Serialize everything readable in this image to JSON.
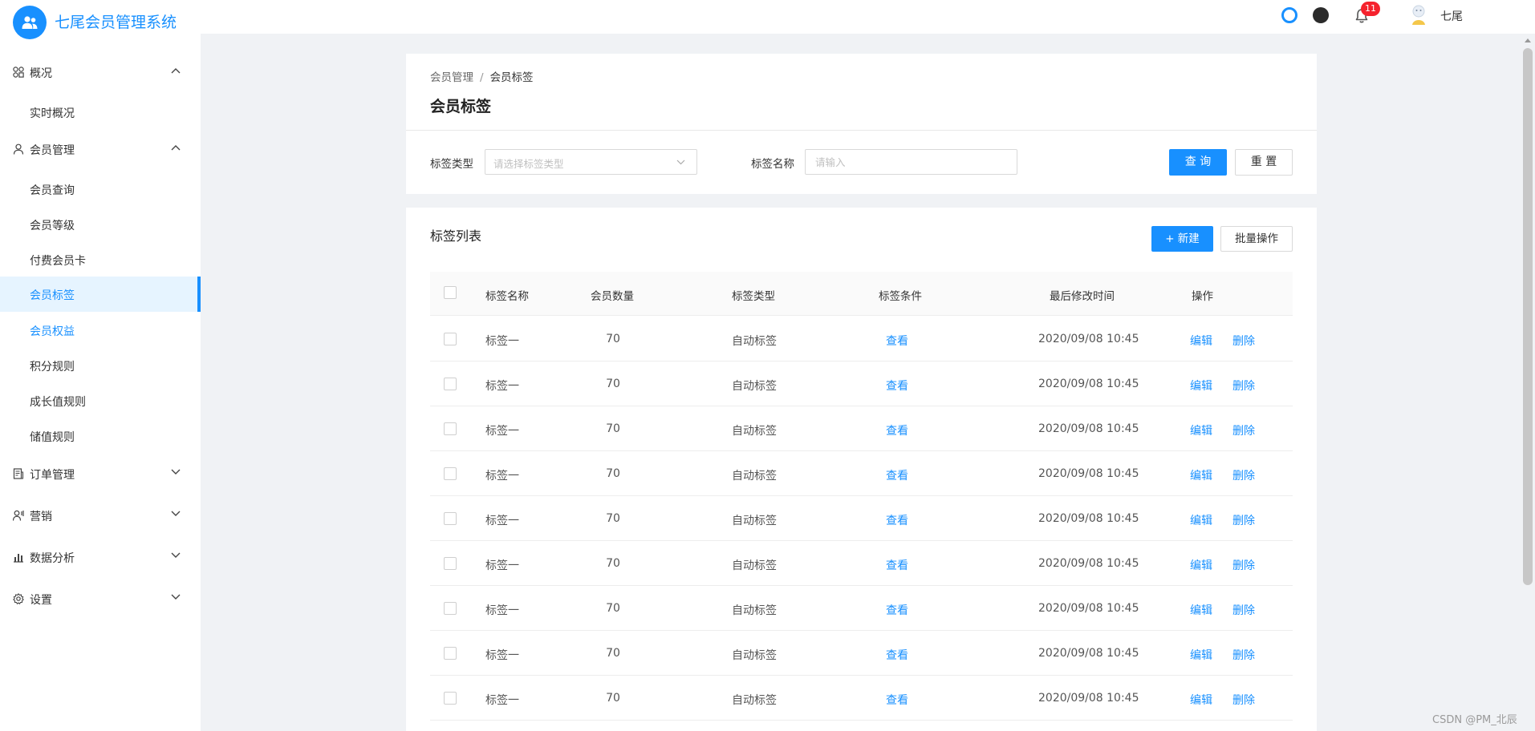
{
  "app": {
    "title": "七尾会员管理系统"
  },
  "header": {
    "notification_count": "11",
    "username": "七尾"
  },
  "sidebar": {
    "groups": [
      {
        "label": "概况",
        "icon": "overview-grid-icon",
        "expanded": true,
        "items": [
          "实时概况"
        ]
      },
      {
        "label": "会员管理",
        "icon": "user-icon",
        "expanded": true,
        "items": [
          "会员查询",
          "会员等级",
          "付费会员卡",
          "会员标签",
          "会员权益",
          "积分规则",
          "成长值规则",
          "储值规则"
        ]
      },
      {
        "label": "订单管理",
        "icon": "order-document-icon",
        "expanded": false
      },
      {
        "label": "营销",
        "icon": "marketing-user-icon",
        "expanded": false
      },
      {
        "label": "数据分析",
        "icon": "bar-chart-icon",
        "expanded": false
      },
      {
        "label": "设置",
        "icon": "gear-icon",
        "expanded": false
      }
    ],
    "active_item": "会员标签",
    "highlighted_item": "会员权益"
  },
  "breadcrumb": {
    "parent": "会员管理",
    "separator": "/",
    "current": "会员标签"
  },
  "page_title": "会员标签",
  "filters": {
    "tag_type_label": "标签类型",
    "tag_type_placeholder": "请选择标签类型",
    "tag_name_label": "标签名称",
    "tag_name_placeholder": "请输入",
    "query_button": "查 询",
    "reset_button": "重 置"
  },
  "list": {
    "title": "标签列表",
    "new_button": "+ 新建",
    "batch_button": "批量操作",
    "columns": [
      "标签名称",
      "会员数量",
      "标签类型",
      "标签条件",
      "最后修改时间",
      "操作"
    ],
    "rows": [
      {
        "name": "标签一",
        "count": "70",
        "type": "自动标签",
        "condition": "查看",
        "modified": "2020/09/08 10:45",
        "edit": "编辑",
        "delete": "删除"
      },
      {
        "name": "标签一",
        "count": "70",
        "type": "自动标签",
        "condition": "查看",
        "modified": "2020/09/08 10:45",
        "edit": "编辑",
        "delete": "删除"
      },
      {
        "name": "标签一",
        "count": "70",
        "type": "自动标签",
        "condition": "查看",
        "modified": "2020/09/08 10:45",
        "edit": "编辑",
        "delete": "删除"
      },
      {
        "name": "标签一",
        "count": "70",
        "type": "自动标签",
        "condition": "查看",
        "modified": "2020/09/08 10:45",
        "edit": "编辑",
        "delete": "删除"
      },
      {
        "name": "标签一",
        "count": "70",
        "type": "自动标签",
        "condition": "查看",
        "modified": "2020/09/08 10:45",
        "edit": "编辑",
        "delete": "删除"
      },
      {
        "name": "标签一",
        "count": "70",
        "type": "自动标签",
        "condition": "查看",
        "modified": "2020/09/08 10:45",
        "edit": "编辑",
        "delete": "删除"
      },
      {
        "name": "标签一",
        "count": "70",
        "type": "自动标签",
        "condition": "查看",
        "modified": "2020/09/08 10:45",
        "edit": "编辑",
        "delete": "删除"
      },
      {
        "name": "标签一",
        "count": "70",
        "type": "自动标签",
        "condition": "查看",
        "modified": "2020/09/08 10:45",
        "edit": "编辑",
        "delete": "删除"
      },
      {
        "name": "标签一",
        "count": "70",
        "type": "自动标签",
        "condition": "查看",
        "modified": "2020/09/08 10:45",
        "edit": "编辑",
        "delete": "删除"
      }
    ]
  },
  "watermark": "CSDN @PM_北辰",
  "colors": {
    "primary": "#1890ff",
    "badge": "#f5222d",
    "background": "#f0f2f5"
  }
}
